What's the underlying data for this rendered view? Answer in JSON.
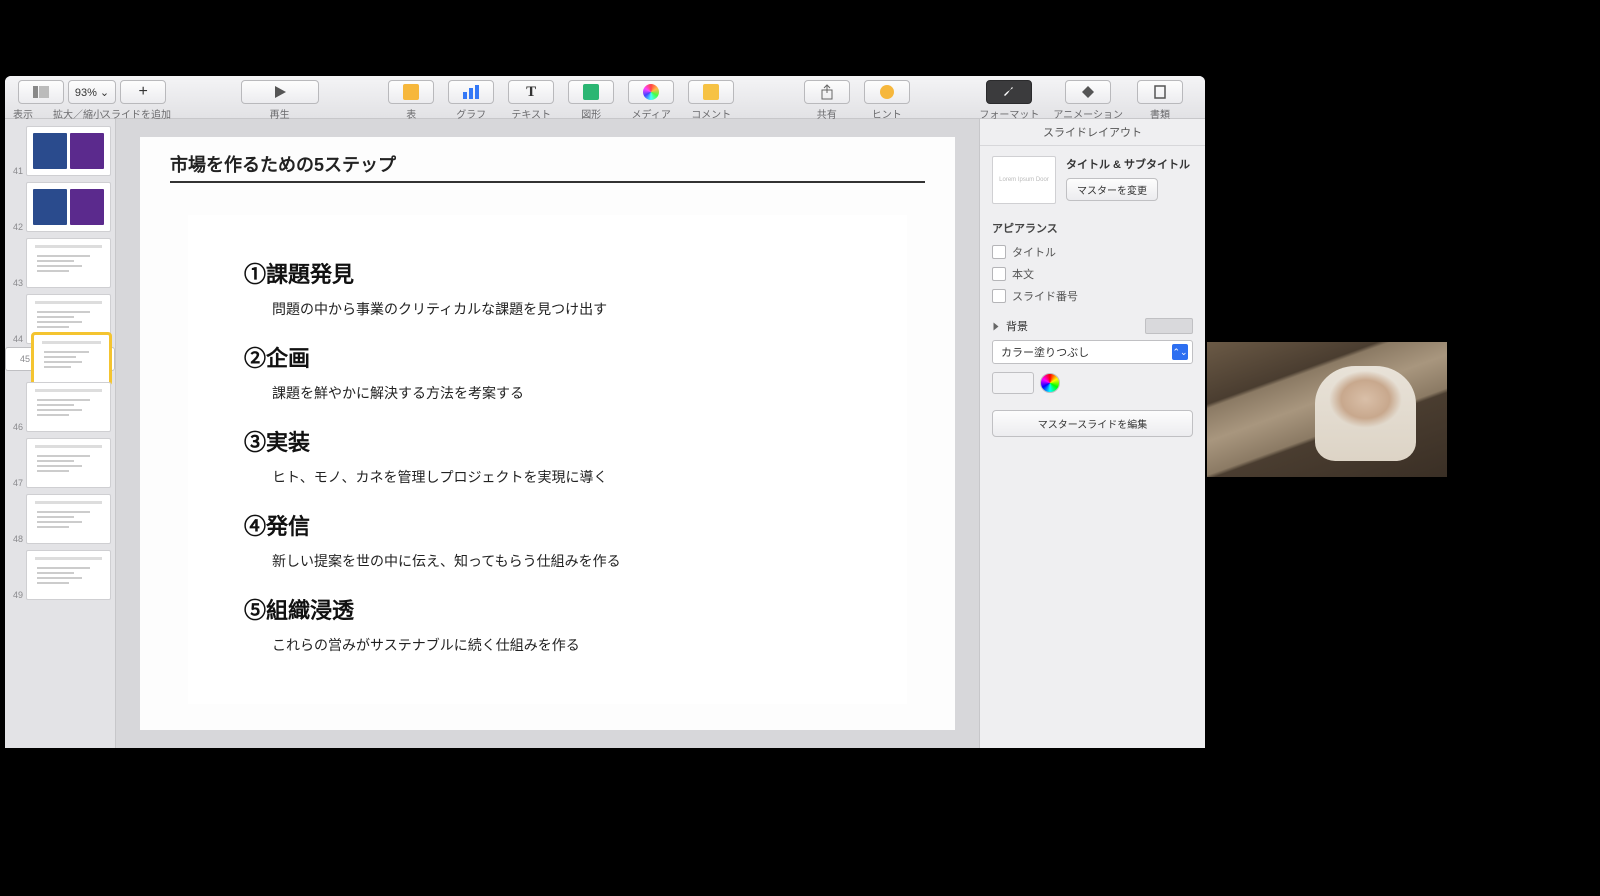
{
  "toolbar": {
    "view": "表示",
    "zoom": "93% ⌄",
    "zoom_label": "拡大／縮小",
    "add": "スライドを追加",
    "play": "再生",
    "table": "表",
    "chart": "グラフ",
    "text": "テキスト",
    "shape": "図形",
    "media": "メディア",
    "comment": "コメント",
    "share": "共有",
    "hint": "ヒント",
    "format": "フォーマット",
    "anim": "アニメーション",
    "doc": "書類"
  },
  "thumbs": [
    41,
    42,
    43,
    44,
    45,
    46,
    47,
    48,
    49
  ],
  "selected": 45,
  "slide": {
    "title": "市場を作るための5ステップ",
    "steps": [
      {
        "h": "①課題発見",
        "p": "問題の中から事業のクリティカルな課題を見つけ出す"
      },
      {
        "h": "②企画",
        "p": "課題を鮮やかに解決する方法を考案する"
      },
      {
        "h": "③実装",
        "p": "ヒト、モノ、カネを管理しプロジェクトを実現に導く"
      },
      {
        "h": "④発信",
        "p": "新しい提案を世の中に伝え、知ってもらう仕組みを作る"
      },
      {
        "h": "⑤組織浸透",
        "p": "これらの営みがサステナブルに続く仕組みを作る"
      }
    ]
  },
  "inspector": {
    "heading": "スライドレイアウト",
    "layout_name": "タイトル & サブタイトル",
    "layout_thumb": "Lorem Ipsum Door",
    "change_master": "マスターを変更",
    "appearance": "アピアランス",
    "chk_title": "タイトル",
    "chk_body": "本文",
    "chk_num": "スライド番号",
    "bg": "背景",
    "fill": "カラー塗りつぶし",
    "edit_master": "マスタースライドを編集"
  }
}
